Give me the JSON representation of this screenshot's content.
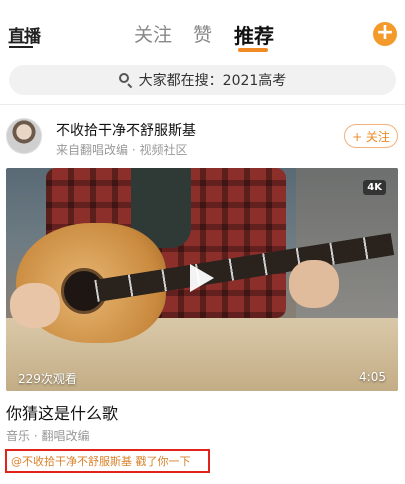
{
  "topnav": {
    "live_label": "直播",
    "tabs": [
      {
        "label": "关注",
        "active": false
      },
      {
        "label": "赞",
        "active": false
      },
      {
        "label": "推荐",
        "active": true
      }
    ],
    "accent_color": "#f08a24",
    "plus_icon": "plus-circle-icon",
    "plus_label": "+"
  },
  "search": {
    "icon": "search-icon",
    "text": "大家都在搜：2021高考"
  },
  "post": {
    "author": "不收拾干净不舒服斯基",
    "source": "来自翻唱改编 · 视频社区",
    "follow_label": "+ 关注",
    "video": {
      "quality_badge": "4K",
      "views": "229次观看",
      "duration": "4:05",
      "play_icon": "play-icon"
    },
    "caption": "你猜这是什么歌",
    "tags": "音乐 · 翻唱改编",
    "mention": "@不收拾干净不舒服斯基 戳了你一下"
  }
}
